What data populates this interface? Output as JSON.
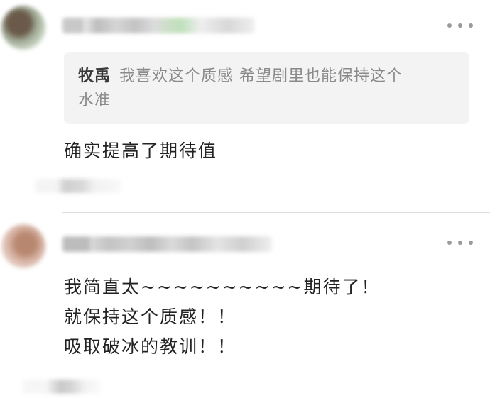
{
  "comments": [
    {
      "quote": {
        "author": "牧禹",
        "lines": [
          "我喜欢这个质感 希望剧里也能保持这个",
          "水准"
        ]
      },
      "text": "确实提高了期待值"
    },
    {
      "lines": [
        "我简直太~~~~~~~~~~期待了！",
        "就保持这个质感！！",
        "吸取破冰的教训！！"
      ]
    }
  ]
}
